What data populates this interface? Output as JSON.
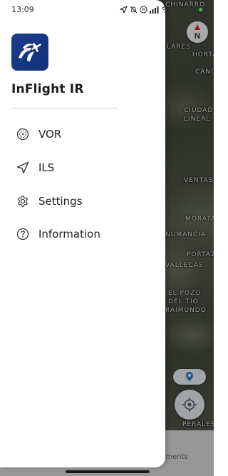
{
  "status_bar": {
    "time": "13:09",
    "icons": [
      "navigation-icon",
      "bell-off-icon",
      "r-circle-icon",
      "signal-icon",
      "wifi-icon"
    ],
    "indicator_color": "#33c25a"
  },
  "drawer": {
    "app_title": "InFlight IR",
    "menu": [
      {
        "label": "VOR",
        "icon": "vor-icon"
      },
      {
        "label": "ILS",
        "icon": "navigation-arrow-icon"
      },
      {
        "label": "Settings",
        "icon": "gear-icon"
      },
      {
        "label": "Information",
        "icon": "help-circle-icon"
      }
    ]
  },
  "map": {
    "labels": [
      "CHINARRO",
      "LARES",
      "HORTA",
      "CANI",
      "CIUDAD",
      "LINEAL",
      "VENTAS",
      "MORATA",
      "NUMANCIA",
      "PORTAZ",
      "VALLECAS",
      "EL POZO",
      "DEL TIO",
      "RAIMUNDO",
      "PERALES"
    ],
    "compass_label": "N",
    "accent_color": "#2a7fd4"
  },
  "bottom_bar": {
    "partial_text": "uments"
  }
}
